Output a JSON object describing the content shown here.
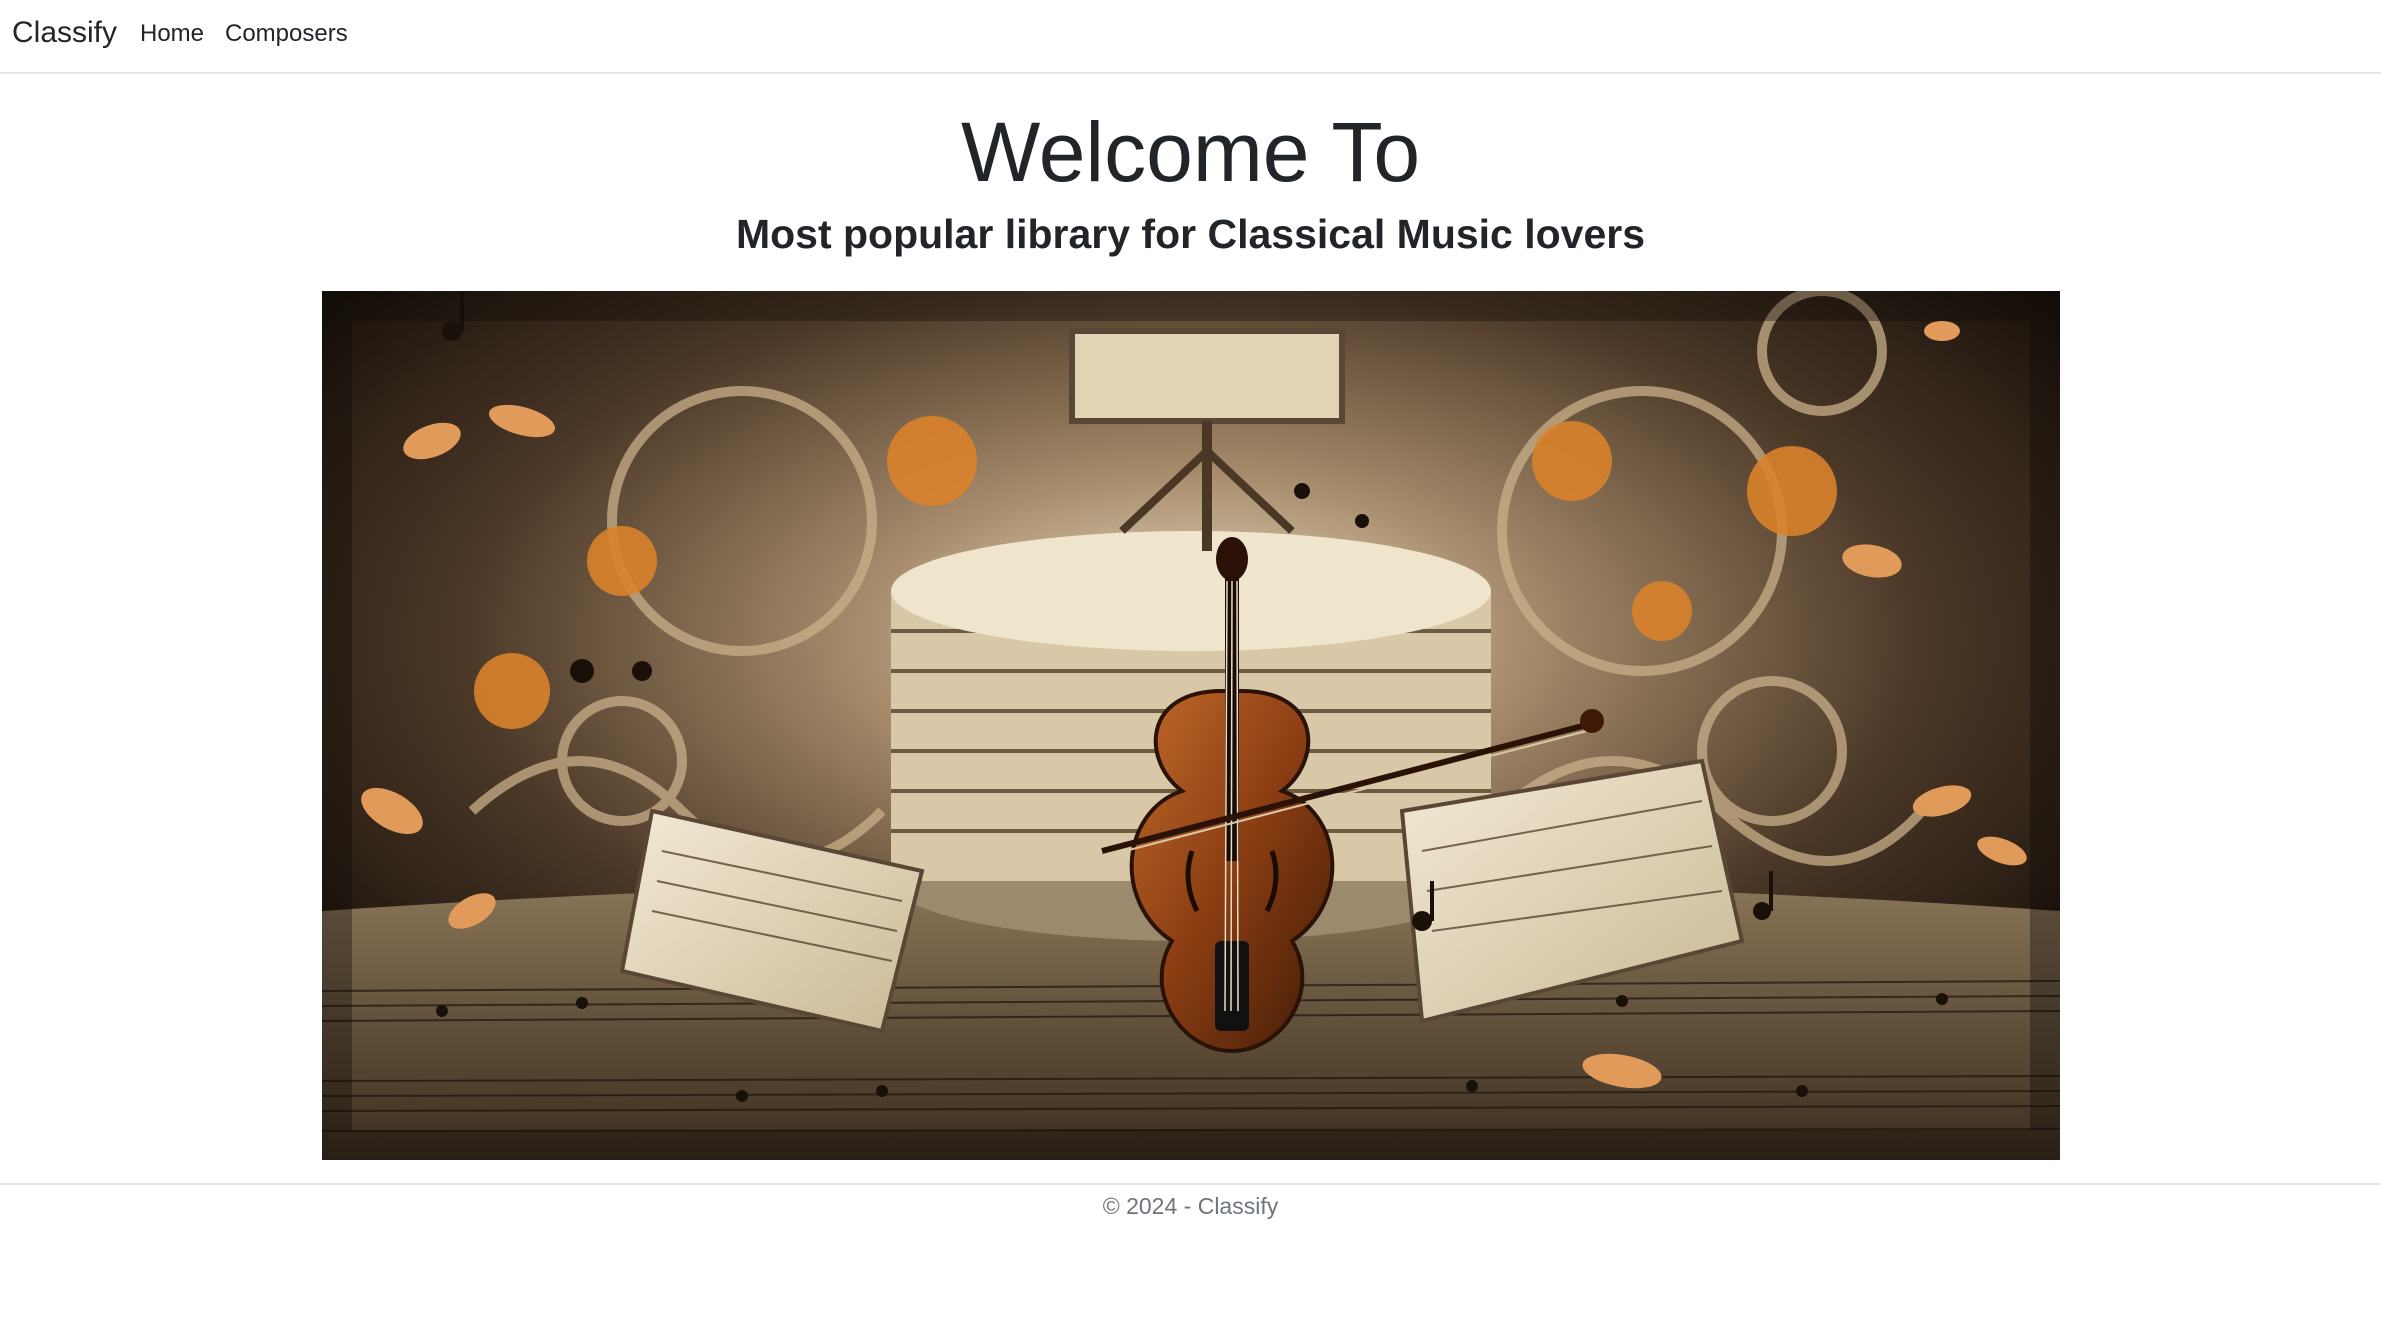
{
  "nav": {
    "brand": "Classify",
    "links": [
      {
        "label": "Home"
      },
      {
        "label": "Composers"
      }
    ]
  },
  "main": {
    "heading": "Welcome To",
    "subheading": "Most popular library for Classical Music lovers",
    "hero_image": {
      "description_icon": "violin-music-artwork-image",
      "colors": {
        "background_dark": "#1a120c",
        "background_mid": "#5a4634",
        "glow": "#e9d8b8",
        "violin": "#8a3d12",
        "paper": "#e8dcc4",
        "accent_orange": "#d9822b"
      }
    }
  },
  "footer": {
    "text": "© 2024 - Classify"
  }
}
